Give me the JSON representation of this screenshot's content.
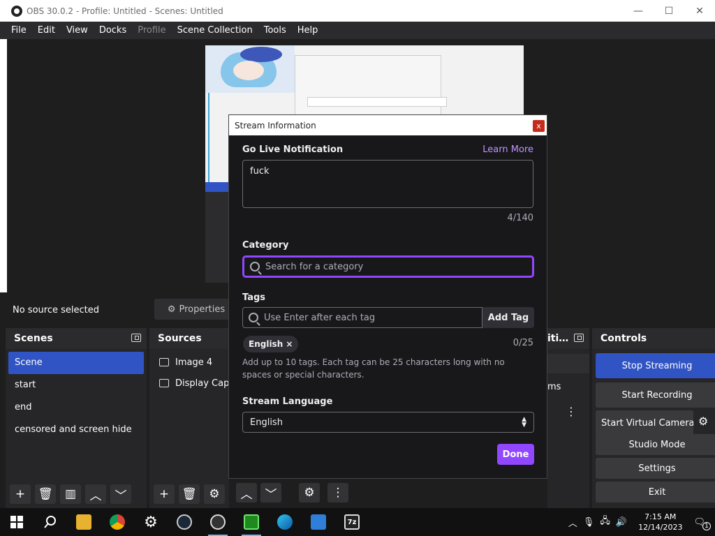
{
  "window": {
    "title": "OBS 30.0.2 - Profile: Untitled - Scenes: Untitled",
    "minimize": "—",
    "maximize": "☐",
    "close": "✕"
  },
  "menu": {
    "items": [
      "File",
      "Edit",
      "View",
      "Docks",
      "Profile",
      "Scene Collection",
      "Tools",
      "Help"
    ]
  },
  "source_bar": {
    "no_source": "No source selected",
    "properties": "Properties"
  },
  "scenes": {
    "header": "Scenes",
    "items": [
      "Scene",
      "start",
      "end",
      "censored and screen hide"
    ]
  },
  "sources": {
    "header": "Sources",
    "items": [
      "Image 4",
      "Display Capture"
    ]
  },
  "mixer": {
    "header": "iti…",
    "ms_label": "ms"
  },
  "controls": {
    "header": "Controls",
    "stop_streaming": "Stop Streaming",
    "start_recording": "Start Recording",
    "start_virtual_camera": "Start Virtual Camera",
    "studio_mode": "Studio Mode",
    "settings": "Settings",
    "exit": "Exit"
  },
  "modal": {
    "title": "Stream Information",
    "close": "x",
    "go_live_label": "Go Live Notification",
    "learn_more": "Learn More",
    "notification_text": "fuck",
    "notification_count": "4/140",
    "category_label": "Category",
    "category_placeholder": "Search for a category",
    "tags_label": "Tags",
    "tags_placeholder": "Use Enter after each tag",
    "add_tag": "Add Tag",
    "tag_chip": "English ×",
    "tag_count": "0/25",
    "tag_help": "Add up to 10 tags. Each tag can be 25 characters long with no spaces or special characters.",
    "language_label": "Stream Language",
    "language_value": "English",
    "done": "Done"
  },
  "taskbar": {
    "time": "7:15 AM",
    "date": "12/14/2023",
    "notification_count": "1"
  },
  "colors": {
    "accent_purple": "#9147ff",
    "obs_selection_blue": "#3154c4"
  }
}
